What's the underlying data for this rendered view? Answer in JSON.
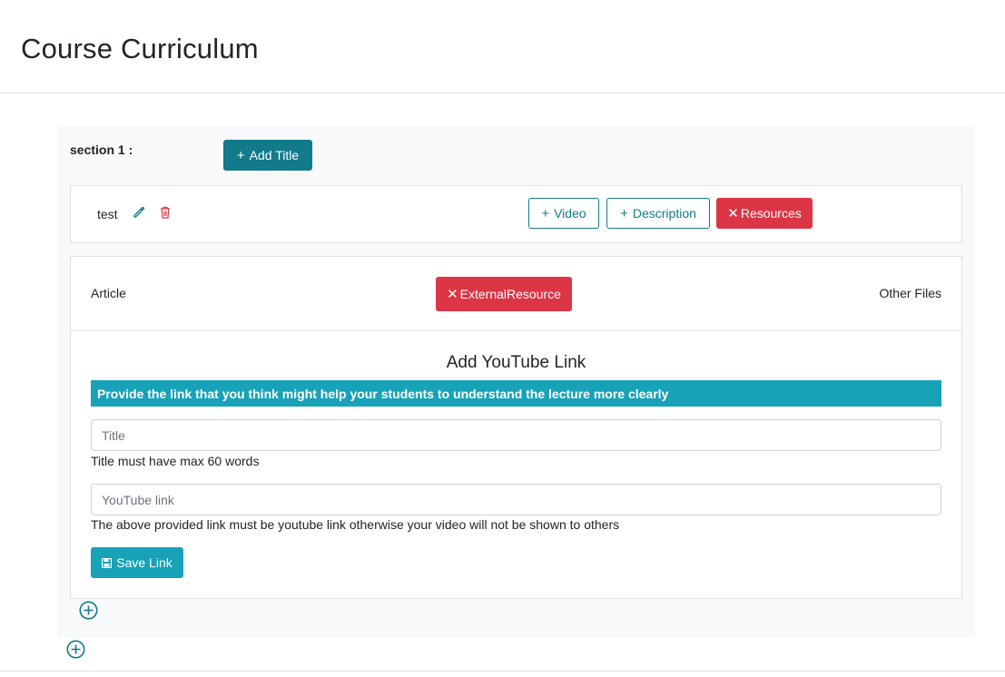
{
  "page": {
    "title": "Course Curriculum"
  },
  "section": {
    "label": "section 1 :",
    "add_title_label": "Add Title",
    "lecture": {
      "name": "test",
      "buttons": {
        "video": "Video",
        "description": "Description",
        "resources": "Resources"
      }
    },
    "resources": {
      "tabs": {
        "article": "Article",
        "external": "ExternalResource",
        "other": "Other Files"
      },
      "form": {
        "title": "Add YouTube Link",
        "banner": "Provide the link that you think might help your students to understand the lecture more clearly",
        "title_placeholder": "Title",
        "title_help": "Title must have max 60 words",
        "link_placeholder": "YouTube link",
        "link_help": "The above provided link must be youtube link otherwise your video will not be shown to others",
        "save_label": "Save Link"
      }
    }
  },
  "colors": {
    "teal": "#117a8b",
    "info": "#17a2b8",
    "danger": "#dc3545",
    "panel": "#f8f9fa"
  },
  "icons": [
    "plus-icon",
    "pencil-icon",
    "trash-icon",
    "close-icon",
    "save-icon",
    "plus-circle-icon"
  ]
}
